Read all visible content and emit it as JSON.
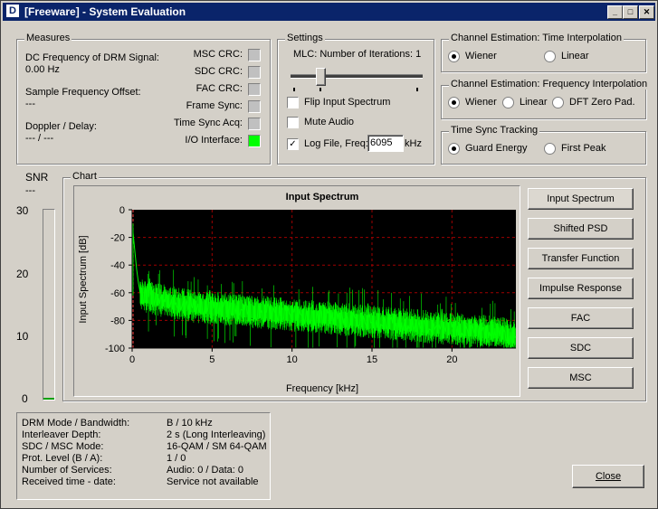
{
  "window": {
    "title": "[Freeware] - System Evaluation",
    "icon": "drm-app-icon",
    "min_label": "_",
    "max_label": "□",
    "close_label": "✕"
  },
  "measures": {
    "title": "Measures",
    "dc_label": "DC Frequency of DRM Signal:",
    "dc_value": "0.00 Hz",
    "sfo_label": "Sample Frequency Offset:",
    "sfo_value": "---",
    "doppler_label": "Doppler / Delay:",
    "doppler_value": "--- / ---",
    "indicators": [
      {
        "label": "MSC CRC:",
        "on": false
      },
      {
        "label": "SDC CRC:",
        "on": false
      },
      {
        "label": "FAC CRC:",
        "on": false
      },
      {
        "label": "Frame Sync:",
        "on": false
      },
      {
        "label": "Time Sync Acq:",
        "on": false
      },
      {
        "label": "I/O Interface:",
        "on": true
      }
    ]
  },
  "settings": {
    "title": "Settings",
    "mlc_label": "MLC: Number of Iterations: 1",
    "mlc_iterations": 1,
    "flip_label": "Flip Input Spectrum",
    "flip_checked": false,
    "mute_label": "Mute Audio",
    "mute_checked": false,
    "log_label": "Log File, Freq:",
    "log_checked": true,
    "freq_value": "6095",
    "freq_unit": "kHz"
  },
  "time_interp": {
    "title": "Channel Estimation: Time Interpolation",
    "options": [
      "Wiener",
      "Linear"
    ],
    "selected": 0
  },
  "freq_interp": {
    "title": "Channel Estimation: Frequency Interpolation",
    "options": [
      "Wiener",
      "Linear",
      "DFT Zero Pad."
    ],
    "selected": 0
  },
  "time_sync": {
    "title": "Time Sync Tracking",
    "options": [
      "Guard Energy",
      "First Peak"
    ],
    "selected": 0
  },
  "snr": {
    "title": "SNR",
    "value": "---",
    "ticks": [
      "30",
      "20",
      "10",
      "0"
    ]
  },
  "chart_group": {
    "title": "Chart"
  },
  "chart_buttons": [
    "Input Spectrum",
    "Shifted PSD",
    "Transfer Function",
    "Impulse Response",
    "FAC",
    "SDC",
    "MSC"
  ],
  "chart_data": {
    "type": "line",
    "title": "Input Spectrum",
    "xlabel": "Frequency [kHz]",
    "ylabel": "Input Spectrum [dB]",
    "xlim": [
      0,
      24
    ],
    "ylim": [
      -100,
      0
    ],
    "xticks": [
      "0",
      "5",
      "10",
      "15",
      "20"
    ],
    "yticks": [
      "0",
      "-20",
      "-40",
      "-60",
      "-80",
      "-100"
    ],
    "grid": true,
    "series": [
      {
        "color": "#00ff00",
        "x": [
          0,
          0.3,
          0.5,
          1,
          2,
          3,
          4,
          5,
          6,
          7,
          8,
          9,
          10,
          11,
          12,
          13,
          14,
          15,
          16,
          17,
          18,
          19,
          20,
          21,
          22,
          23,
          24
        ],
        "y": [
          -10,
          -45,
          -62,
          -63,
          -66,
          -68,
          -70,
          -71,
          -72,
          -73,
          -74,
          -75,
          -76,
          -77,
          -78,
          -79,
          -80,
          -81,
          -82,
          -83,
          -84,
          -85,
          -86,
          -87,
          -88,
          -89,
          -92
        ]
      }
    ],
    "markers": [
      {
        "x": 0,
        "color": "#ff4040"
      }
    ]
  },
  "info": {
    "rows": [
      {
        "label": "DRM Mode / Bandwidth:",
        "value": "B / 10 kHz"
      },
      {
        "label": "Interleaver Depth:",
        "value": "2 s (Long Interleaving)"
      },
      {
        "label": "SDC / MSC Mode:",
        "value": "16-QAM / SM 64-QAM"
      },
      {
        "label": "Prot. Level (B / A):",
        "value": "1 / 0"
      },
      {
        "label": "Number of Services:",
        "value": "Audio: 0 / Data: 0"
      },
      {
        "label": "Received time - date:",
        "value": "Service not available"
      }
    ]
  },
  "close_button": "Close"
}
